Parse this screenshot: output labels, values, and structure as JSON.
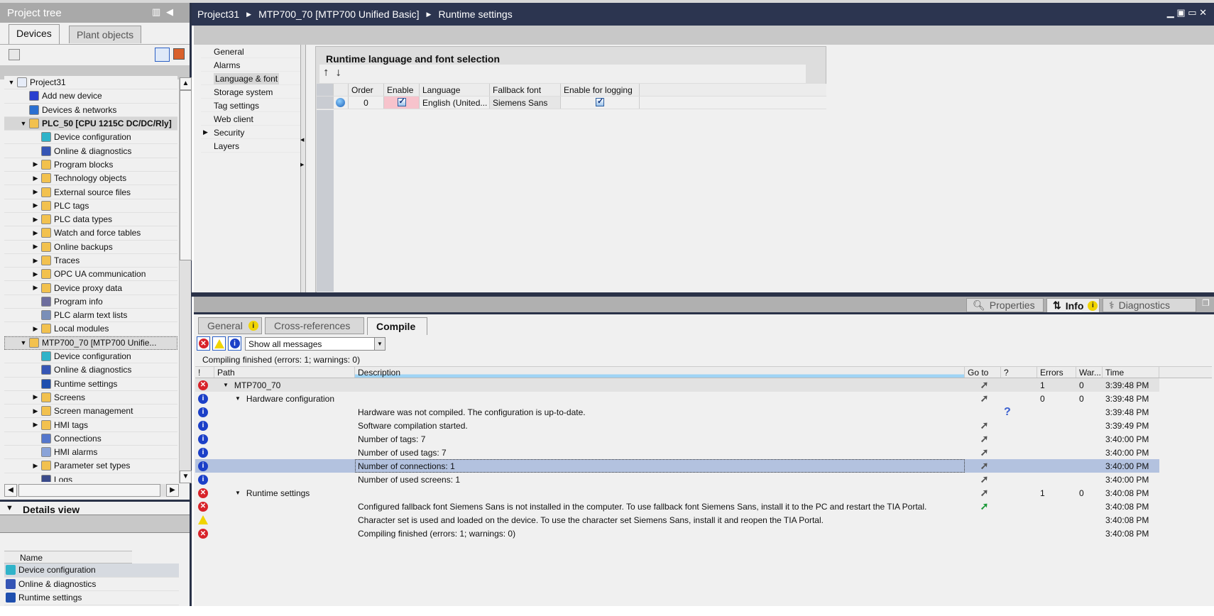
{
  "project_tree": {
    "title": "Project tree",
    "tabs": [
      "Devices",
      "Plant objects"
    ],
    "items": [
      {
        "label": "Project31",
        "level": 0,
        "arrow": "open",
        "icon": "project-icon",
        "color": "#e6ecf8"
      },
      {
        "label": "Add new device",
        "level": 1,
        "arrow": "",
        "icon": "add-device-icon",
        "color": "#2a3fcf"
      },
      {
        "label": "Devices & networks",
        "level": 1,
        "arrow": "",
        "icon": "network-icon",
        "color": "#2a6fd0"
      },
      {
        "label": "PLC_50 [CPU 1215C DC/DC/Rly]",
        "level": 1,
        "arrow": "open",
        "icon": "plc-folder-icon",
        "color": "#f2c14e",
        "state": "sel"
      },
      {
        "label": "Device configuration",
        "level": 2,
        "arrow": "",
        "icon": "device-config-icon",
        "color": "#2fb3c9"
      },
      {
        "label": "Online & diagnostics",
        "level": 2,
        "arrow": "",
        "icon": "diagnostics-icon",
        "color": "#3555b5"
      },
      {
        "label": "Program blocks",
        "level": 2,
        "arrow": "closed",
        "icon": "folder-icon",
        "color": "#f2c14e"
      },
      {
        "label": "Technology objects",
        "level": 2,
        "arrow": "closed",
        "icon": "folder-icon",
        "color": "#f2c14e"
      },
      {
        "label": "External source files",
        "level": 2,
        "arrow": "closed",
        "icon": "folder-icon",
        "color": "#f2c14e"
      },
      {
        "label": "PLC tags",
        "level": 2,
        "arrow": "closed",
        "icon": "folder-icon",
        "color": "#f2c14e"
      },
      {
        "label": "PLC data types",
        "level": 2,
        "arrow": "closed",
        "icon": "folder-icon",
        "color": "#f2c14e"
      },
      {
        "label": "Watch and force tables",
        "level": 2,
        "arrow": "closed",
        "icon": "folder-icon",
        "color": "#f2c14e"
      },
      {
        "label": "Online backups",
        "level": 2,
        "arrow": "closed",
        "icon": "folder-icon",
        "color": "#f2c14e"
      },
      {
        "label": "Traces",
        "level": 2,
        "arrow": "closed",
        "icon": "folder-icon",
        "color": "#f2c14e"
      },
      {
        "label": "OPC UA communication",
        "level": 2,
        "arrow": "closed",
        "icon": "folder-icon",
        "color": "#f2c14e"
      },
      {
        "label": "Device proxy data",
        "level": 2,
        "arrow": "closed",
        "icon": "folder-icon",
        "color": "#f2c14e"
      },
      {
        "label": "Program info",
        "level": 2,
        "arrow": "",
        "icon": "program-info-icon",
        "color": "#6d6d9e"
      },
      {
        "label": "PLC alarm text lists",
        "level": 2,
        "arrow": "",
        "icon": "text-list-icon",
        "color": "#7a8fb8"
      },
      {
        "label": "Local modules",
        "level": 2,
        "arrow": "closed",
        "icon": "folder-icon",
        "color": "#f2c14e"
      },
      {
        "label": "MTP700_70 [MTP700 Unifie...",
        "level": 1,
        "arrow": "open",
        "icon": "hmi-folder-icon",
        "color": "#f2c14e",
        "state": "dash"
      },
      {
        "label": "Device configuration",
        "level": 2,
        "arrow": "",
        "icon": "device-config-icon",
        "color": "#2fb3c9"
      },
      {
        "label": "Online & diagnostics",
        "level": 2,
        "arrow": "",
        "icon": "diagnostics-icon",
        "color": "#3555b5"
      },
      {
        "label": "Runtime settings",
        "level": 2,
        "arrow": "",
        "icon": "wrench-icon",
        "color": "#1f4fae"
      },
      {
        "label": "Screens",
        "level": 2,
        "arrow": "closed",
        "icon": "folder-icon",
        "color": "#f2c14e"
      },
      {
        "label": "Screen management",
        "level": 2,
        "arrow": "closed",
        "icon": "folder-icon",
        "color": "#f2c14e"
      },
      {
        "label": "HMI tags",
        "level": 2,
        "arrow": "closed",
        "icon": "folder-icon",
        "color": "#f2c14e"
      },
      {
        "label": "Connections",
        "level": 2,
        "arrow": "",
        "icon": "connections-icon",
        "color": "#5577cc"
      },
      {
        "label": "HMI alarms",
        "level": 2,
        "arrow": "",
        "icon": "alarms-icon",
        "color": "#8aa3d8"
      },
      {
        "label": "Parameter set types",
        "level": 2,
        "arrow": "closed",
        "icon": "folder-icon",
        "color": "#f2c14e"
      },
      {
        "label": "Logs",
        "level": 2,
        "arrow": "",
        "icon": "logs-icon",
        "color": "#3a4a8a"
      }
    ]
  },
  "details_view": {
    "title": "Details view",
    "column": "Name",
    "items": [
      {
        "label": "Device configuration",
        "icon": "device-config-icon",
        "color": "#2fb3c9"
      },
      {
        "label": "Online & diagnostics",
        "icon": "diagnostics-icon",
        "color": "#3555b5"
      },
      {
        "label": "Runtime settings",
        "icon": "wrench-icon",
        "color": "#1f4fae"
      }
    ]
  },
  "breadcrumb": [
    "Project31",
    "MTP700_70 [MTP700 Unified Basic]",
    "Runtime settings"
  ],
  "editor": {
    "nav": [
      {
        "label": "General"
      },
      {
        "label": "Alarms"
      },
      {
        "label": "Language & font",
        "active": true
      },
      {
        "label": "Storage system"
      },
      {
        "label": "Tag settings"
      },
      {
        "label": "Web client"
      },
      {
        "label": "Security",
        "arrow": true
      },
      {
        "label": "Layers"
      }
    ],
    "panel_title": "Runtime language and font selection",
    "columns": [
      "Order",
      "Enable",
      "Language",
      "Fallback font",
      "Enable for logging"
    ],
    "rows": [
      {
        "order": "0",
        "enable": true,
        "language": "English (United...",
        "fallback": "Siemens Sans",
        "logging": true
      }
    ]
  },
  "inspector_tabs": [
    "Properties",
    "Info",
    "Diagnostics"
  ],
  "info_tabs": [
    "General",
    "Cross-references",
    "Compile"
  ],
  "filter": {
    "selected": "Show all messages"
  },
  "status": "Compiling finished (errors: 1; warnings: 0)",
  "messages": {
    "columns": [
      "!",
      "Path",
      "Description",
      "Go to",
      "?",
      "Errors",
      "War...",
      "Time"
    ],
    "rows": [
      {
        "type": "error",
        "path": "MTP700_70",
        "level": 0,
        "desc": "",
        "goto": "gray",
        "help": "",
        "errors": "1",
        "warnings": "0",
        "time": "3:39:48 PM",
        "style": "g"
      },
      {
        "type": "info",
        "path": "Hardware configuration",
        "level": 1,
        "desc": "",
        "goto": "gray",
        "help": "",
        "errors": "0",
        "warnings": "0",
        "time": "3:39:48 PM"
      },
      {
        "type": "info",
        "path": "",
        "desc": "Hardware was not compiled. The configuration is up-to-date.",
        "goto": "",
        "help": "?",
        "errors": "",
        "warnings": "",
        "time": "3:39:48 PM"
      },
      {
        "type": "info",
        "path": "",
        "desc": "Software compilation started.",
        "goto": "gray",
        "help": "",
        "errors": "",
        "warnings": "",
        "time": "3:39:49 PM"
      },
      {
        "type": "info",
        "path": "",
        "desc": "Number of tags: 7",
        "goto": "gray",
        "help": "",
        "errors": "",
        "warnings": "",
        "time": "3:40:00 PM"
      },
      {
        "type": "info",
        "path": "",
        "desc": "Number of used tags: 7",
        "goto": "gray",
        "help": "",
        "errors": "",
        "warnings": "",
        "time": "3:40:00 PM"
      },
      {
        "type": "info",
        "path": "",
        "desc": "Number of connections: 1",
        "goto": "gray",
        "help": "",
        "errors": "",
        "warnings": "",
        "time": "3:40:00 PM",
        "style": "sel"
      },
      {
        "type": "info",
        "path": "",
        "desc": "Number of used screens: 1",
        "goto": "gray",
        "help": "",
        "errors": "",
        "warnings": "",
        "time": "3:40:00 PM"
      },
      {
        "type": "error",
        "path": "Runtime settings",
        "level": 1,
        "desc": "",
        "goto": "gray",
        "help": "",
        "errors": "1",
        "warnings": "0",
        "time": "3:40:08 PM"
      },
      {
        "type": "error",
        "path": "",
        "desc": "Configured fallback font Siemens Sans is not installed in the computer. To use fallback font Siemens Sans, install it to the PC and restart the TIA Portal.",
        "goto": "green",
        "help": "",
        "errors": "",
        "warnings": "",
        "time": "3:40:08 PM"
      },
      {
        "type": "warning",
        "path": "",
        "desc": "Character set is used and loaded on the device. To use the character set Siemens Sans, install it and reopen the TIA Portal.",
        "goto": "",
        "help": "",
        "errors": "",
        "warnings": "",
        "time": "3:40:08 PM"
      },
      {
        "type": "error",
        "path": "",
        "desc": "Compiling finished (errors: 1; warnings: 0)",
        "goto": "",
        "help": "",
        "errors": "",
        "warnings": "",
        "time": "3:40:08 PM"
      }
    ]
  }
}
